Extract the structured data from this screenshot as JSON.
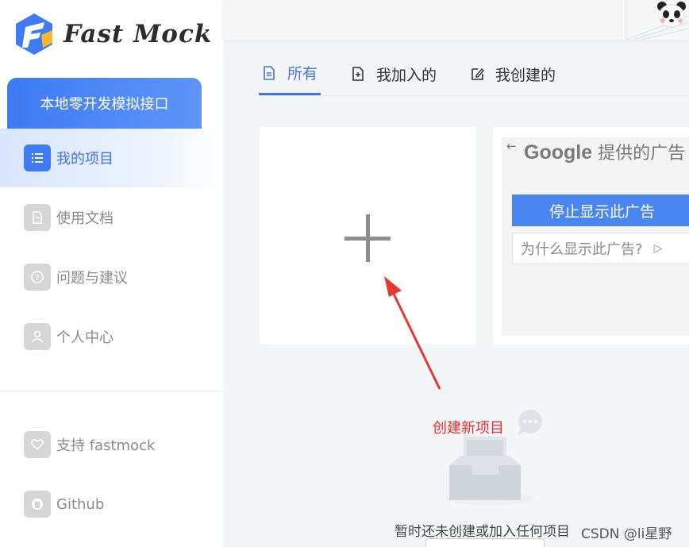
{
  "app": {
    "logo_text": "Fast Mock"
  },
  "sidebar": {
    "cta_label": "本地零开发模拟接口",
    "items": [
      {
        "label": "我的项目",
        "icon": "list-icon",
        "active": true
      },
      {
        "label": "使用文档",
        "icon": "document-icon",
        "active": false
      },
      {
        "label": "问题与建议",
        "icon": "question-icon",
        "active": false
      },
      {
        "label": "个人中心",
        "icon": "user-icon",
        "active": false
      }
    ],
    "bottom_items": [
      {
        "label": "支持 fastmock",
        "icon": "heart-icon"
      },
      {
        "label": "Github",
        "icon": "github-icon"
      }
    ]
  },
  "tabs": [
    {
      "label": "所有",
      "icon": "file-icon",
      "active": true
    },
    {
      "label": "我加入的",
      "icon": "file-plus-icon",
      "active": false
    },
    {
      "label": "我创建的",
      "icon": "edit-icon",
      "active": false
    }
  ],
  "ad": {
    "back": "←",
    "brand": "Google",
    "title": " 提供的广告",
    "stop_label": "停止显示此广告",
    "why_label": "为什么显示此广告?",
    "why_icon": "▷"
  },
  "annotation": {
    "text": "创建新项目",
    "color": "#e32f2f"
  },
  "empty_state": {
    "text": "暂时还未创建或加入任何项目"
  },
  "watermark": "CSDN @li星野",
  "colors": {
    "accent": "#3e7bf4",
    "annotation": "#e32f2f"
  }
}
